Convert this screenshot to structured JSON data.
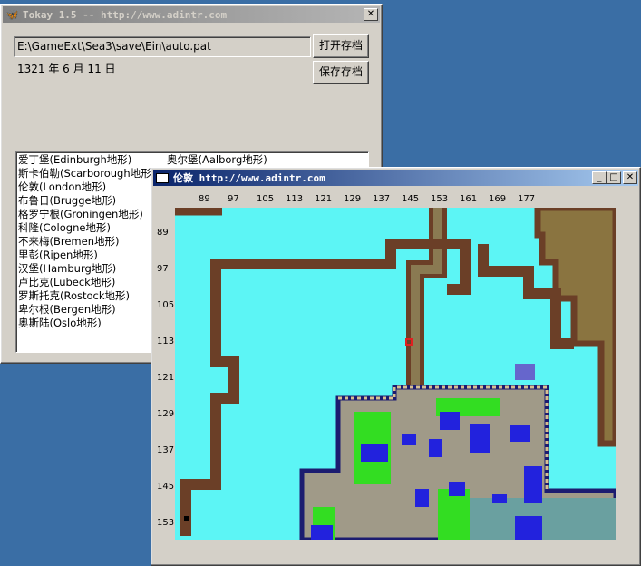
{
  "main_window": {
    "title": "Tokay 1.5 -- http://www.adintr.com",
    "close_label": "✕",
    "save_path": "E:\\GameExt\\Sea3\\save\\Ein\\auto.pat",
    "open_button": "打开存档",
    "save_button": "保存存档",
    "date_text": "1321 年 6 月 11 日",
    "maps_col1": [
      "爱丁堡(Edinburgh地形)",
      "斯卡伯勒(Scarborough地形)",
      "伦敦(London地形)",
      "布鲁日(Brugge地形)",
      "格罗宁根(Groningen地形)",
      "科隆(Cologne地形)",
      "不来梅(Bremen地形)",
      "里彭(Ripen地形)",
      "汉堡(Hamburg地形)",
      "卢比克(Lubeck地形)",
      "罗斯托克(Rostock地形)",
      "卑尔根(Bergen地形)",
      "奥斯陆(Oslo地形)"
    ],
    "maps_col2": [
      "奥尔堡(Aalborg地形)"
    ]
  },
  "map_window": {
    "title": "伦敦  http://www.adintr.com",
    "buttons": [
      "_",
      "□",
      "✕"
    ],
    "x_ticks": [
      "89",
      "97",
      "105",
      "113",
      "121",
      "129",
      "137",
      "145",
      "153",
      "161",
      "169",
      "177"
    ],
    "y_ticks": [
      "89",
      "97",
      "105",
      "113",
      "121",
      "129",
      "137",
      "145",
      "153"
    ]
  },
  "colors": {
    "water": "#5cf5f5",
    "wall": "#6b3f27",
    "land": "#7a6a4a",
    "town": "#a09a88",
    "grass": "#33dd22",
    "roof": "#2222dd"
  }
}
